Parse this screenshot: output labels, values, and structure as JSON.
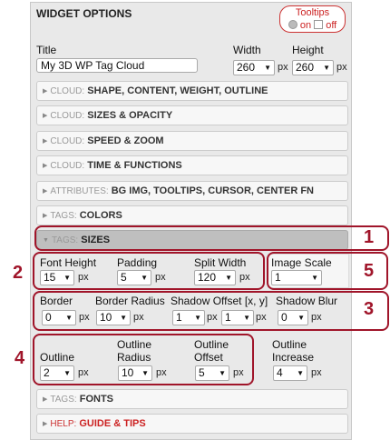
{
  "header": {
    "title": "WIDGET OPTIONS",
    "tooltips_label": "Tooltips",
    "tooltips_on": "on",
    "tooltips_off": "off"
  },
  "fields": {
    "title_label": "Title",
    "title_value": "My 3D WP Tag Cloud",
    "width_label": "Width",
    "width_value": "260",
    "height_label": "Height",
    "height_value": "260",
    "unit_px": "px"
  },
  "sections": [
    {
      "prefix": "CLOUD:",
      "label": "SHAPE, CONTENT, WEIGHT, OUTLINE"
    },
    {
      "prefix": "CLOUD:",
      "label": "SIZES & OPACITY"
    },
    {
      "prefix": "CLOUD:",
      "label": "SPEED & ZOOM"
    },
    {
      "prefix": "CLOUD:",
      "label": "TIME & FUNCTIONS"
    },
    {
      "prefix": "ATTRIBUTES:",
      "label": "BG IMG, TOOLTIPS, CURSOR, CENTER FN"
    },
    {
      "prefix": "TAGS:",
      "label": "COLORS"
    },
    {
      "prefix": "TAGS:",
      "label": "SIZES"
    }
  ],
  "sizes": {
    "font_height_label": "Font Height",
    "font_height_value": "15",
    "padding_label": "Padding",
    "padding_value": "5",
    "split_width_label": "Split Width",
    "split_width_value": "120",
    "image_scale_label": "Image Scale",
    "image_scale_value": "1",
    "border_label": "Border",
    "border_value": "0",
    "border_radius_label": "Border Radius",
    "border_radius_value": "10",
    "shadow_offset_label": "Shadow Offset [x, y]",
    "shadow_offset_x": "1",
    "shadow_offset_y": "1",
    "shadow_blur_label": "Shadow Blur",
    "shadow_blur_value": "0",
    "outline_label": "Outline",
    "outline_value": "2",
    "outline_radius_label_1": "Outline",
    "outline_radius_label_2": "Radius",
    "outline_radius_value": "10",
    "outline_offset_label_1": "Outline",
    "outline_offset_label_2": "Offset",
    "outline_offset_value": "5",
    "outline_increase_label_1": "Outline",
    "outline_increase_label_2": "Increase",
    "outline_increase_value": "4"
  },
  "footer_sections": [
    {
      "prefix": "TAGS:",
      "label": "FONTS"
    },
    {
      "prefix": "HELP:",
      "label": "GUIDE & TIPS"
    }
  ],
  "markers": [
    "1",
    "2",
    "3",
    "4",
    "5"
  ],
  "colors": {
    "annotation": "#a0152a",
    "help": "#c22222"
  }
}
